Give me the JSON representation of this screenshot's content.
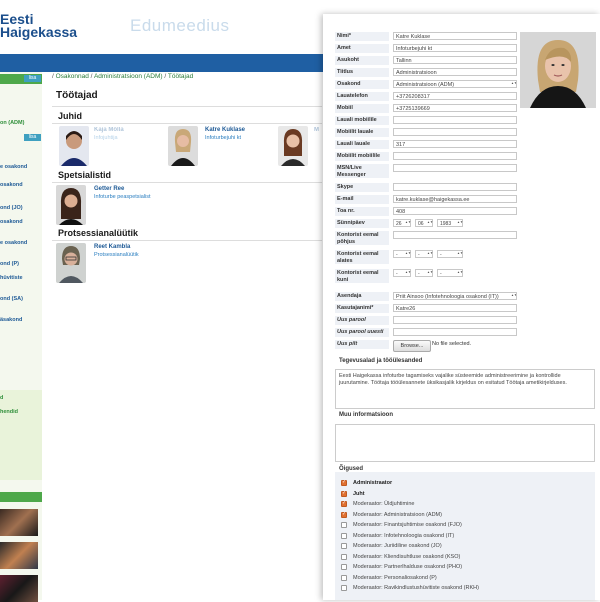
{
  "app": {
    "logo_line1": "Eesti",
    "logo_line2": "Haigekassa",
    "title": "Edumeedius"
  },
  "sidebar": {
    "lisa_label": "lisa",
    "items": [
      "on (ADM)",
      "e osakond",
      "osakond",
      "ond (JO)",
      "osakond",
      "e osakond",
      "ond (P)",
      "hüvitiste",
      "ond (SA)",
      "äsakond",
      "d",
      "hendid"
    ]
  },
  "breadcrumb": {
    "items": [
      "Osakonnad",
      "Administratsioon (ADM)",
      "Töötajad"
    ]
  },
  "staff_page": {
    "heading": "Töötajad",
    "sections": [
      {
        "title": "Juhid"
      },
      {
        "title": "Spetsialistid"
      },
      {
        "title": "Protsessianalüütik"
      }
    ],
    "leaders": [
      {
        "name": "Kaja Mölla",
        "role": "Infojuhtija"
      },
      {
        "name": "Katre Kuklase",
        "role": "Infoturbejuhi kt"
      },
      {
        "name": "M",
        "role": ""
      }
    ],
    "specialists": [
      {
        "name": "Getter Ree",
        "role": "Infoturbe peaspetsialist"
      }
    ],
    "analysts": [
      {
        "name": "Reet Kambla",
        "role": "Protsessianalüütik"
      }
    ]
  },
  "form": {
    "fields": [
      {
        "label": "Nimi*",
        "value": "Katre Kuklase"
      },
      {
        "label": "Amet",
        "value": "Infoturbejuhi kt"
      },
      {
        "label": "Asukoht",
        "value": "Tallinn"
      },
      {
        "label": "Tiitlus",
        "value": "Administratsioon"
      },
      {
        "label": "Osakond",
        "value": "Administratsioon (ADM)"
      },
      {
        "label": "Lauatelefon",
        "value": "+3726208317"
      },
      {
        "label": "Mobiil",
        "value": "+3725139669"
      },
      {
        "label": "Lauali mobiilile",
        "value": ""
      },
      {
        "label": "Mobiilit lauale",
        "value": ""
      },
      {
        "label": "Lauali lauale",
        "value": "317"
      },
      {
        "label": "Mobiilit mobiilile",
        "value": ""
      },
      {
        "label": "MSN/Live Messenger",
        "value": ""
      },
      {
        "label": "Skype",
        "value": ""
      },
      {
        "label": "E-mail",
        "value": "katre.kuklase@haigekassa.ee"
      },
      {
        "label": "Toa nr.",
        "value": "408"
      }
    ],
    "birthday": {
      "label": "Sünnipäev",
      "day": "26",
      "month": "06",
      "year": "1983"
    },
    "absent_reason": {
      "label": "Kontorist eemal põhjus",
      "value": ""
    },
    "absent_from": {
      "label": "Kontorist eemal alates",
      "d": "-",
      "m": "-",
      "y": "-"
    },
    "absent_until": {
      "label": "Kontorist eemal kuni",
      "d": "-",
      "m": "-",
      "y": "-"
    },
    "deputy": {
      "label": "Asendaja",
      "value": "Priit Ainsoo (Infotehnoloogia osakond (IT))"
    },
    "username": {
      "label": "Kasutajanimi*",
      "value": "Katre26"
    },
    "new_password": {
      "label": "Uus parool",
      "value": ""
    },
    "new_password_again": {
      "label": "Uus parool uuesti",
      "value": ""
    },
    "new_photo": {
      "label": "Uus pilt",
      "browse": "Browse...",
      "no_file": "No file selected."
    },
    "duties_title": "Tegevusalad ja tööülesanded",
    "duties_text": "Eesti Haigekassa infoturbe tagamiseks vajalike süsteemide administreerimine ja kontrollide juurutamine. Töötaja tööülesannete üksikasjalik kirjeldus on esitatud Töötaja ametikirjelduses.",
    "other_title": "Muu informatsioon",
    "other_text": "",
    "rights_title": "Õigused",
    "rights": [
      {
        "label": "Administraator",
        "checked": true,
        "bold": true
      },
      {
        "label": "Juht",
        "checked": true,
        "bold": true
      },
      {
        "label": "Moderaator: Üldjuhtimine",
        "checked": true,
        "bold": false
      },
      {
        "label": "Moderaator: Administratsioon (ADM)",
        "checked": true,
        "bold": false
      },
      {
        "label": "Moderaator: Finantsjuhtimise osakond (FJO)",
        "checked": false,
        "bold": false
      },
      {
        "label": "Moderaator: Infotehnoloogia osakond (IT)",
        "checked": false,
        "bold": false
      },
      {
        "label": "Moderaator: Juriidiline osakond (JO)",
        "checked": false,
        "bold": false
      },
      {
        "label": "Moderaator: Kliendisuhtluse osakond (KSO)",
        "checked": false,
        "bold": false
      },
      {
        "label": "Moderaator: Partnerlhalduse osakond (PHO)",
        "checked": false,
        "bold": false
      },
      {
        "label": "Moderaator: Personaliosakond (P)",
        "checked": false,
        "bold": false
      },
      {
        "label": "Moderaator: Ravikindlustushüvitiste osakond (RKH)",
        "checked": false,
        "bold": false
      }
    ]
  },
  "colors": {
    "brand_blue": "#1f5fa3",
    "accent_green": "#4ea84a",
    "check_orange": "#e07030"
  }
}
